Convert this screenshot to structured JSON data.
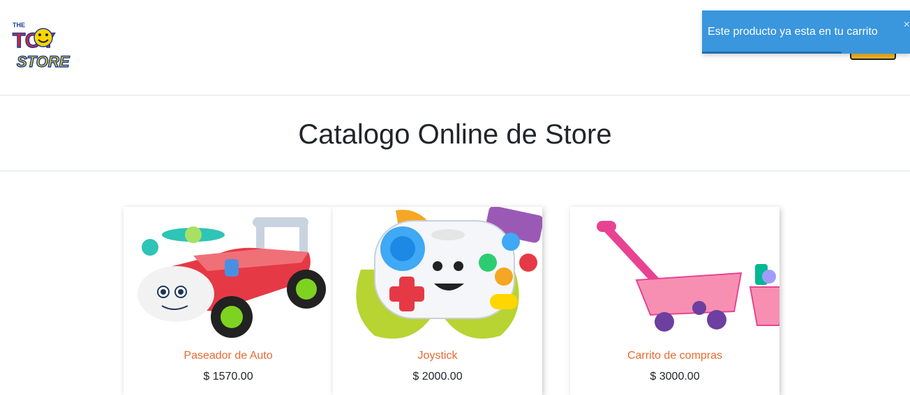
{
  "header": {
    "logo": {
      "line1": "THE",
      "line2": "TOY",
      "line3": "STORE"
    }
  },
  "toast": {
    "message": "Este producto ya esta en tu carrito",
    "close_label": "×",
    "progress": 0.67
  },
  "catalog": {
    "title": "Catalogo Online de Store",
    "products": [
      {
        "name": "Paseador de Auto",
        "price": "$ 1570.00",
        "icon": "ride-on-car-image"
      },
      {
        "name": "Joystick",
        "price": "$ 2000.00",
        "icon": "toy-joystick-image"
      },
      {
        "name": "Carrito de compras",
        "price": "$ 3000.00",
        "icon": "toy-wagon-image"
      }
    ]
  },
  "colors": {
    "toast": "#3a96dd",
    "product_name": "#e8692f",
    "cart_button": "#f0b429"
  }
}
